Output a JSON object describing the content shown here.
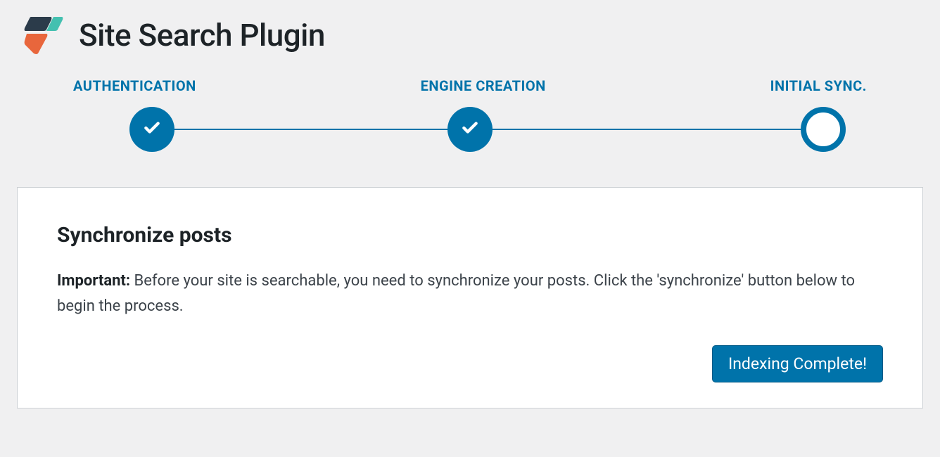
{
  "header": {
    "title": "Site Search Plugin"
  },
  "stepper": {
    "steps": [
      {
        "label": "AUTHENTICATION",
        "complete": true
      },
      {
        "label": "ENGINE CREATION",
        "complete": true
      },
      {
        "label": "INITIAL SYNC.",
        "complete": false
      }
    ]
  },
  "panel": {
    "title": "Synchronize posts",
    "important_label": "Important:",
    "body": " Before your site is searchable, you need to synchronize your posts. Click the 'synchronize' button below to begin the process.",
    "button_label": "Indexing Complete!"
  }
}
